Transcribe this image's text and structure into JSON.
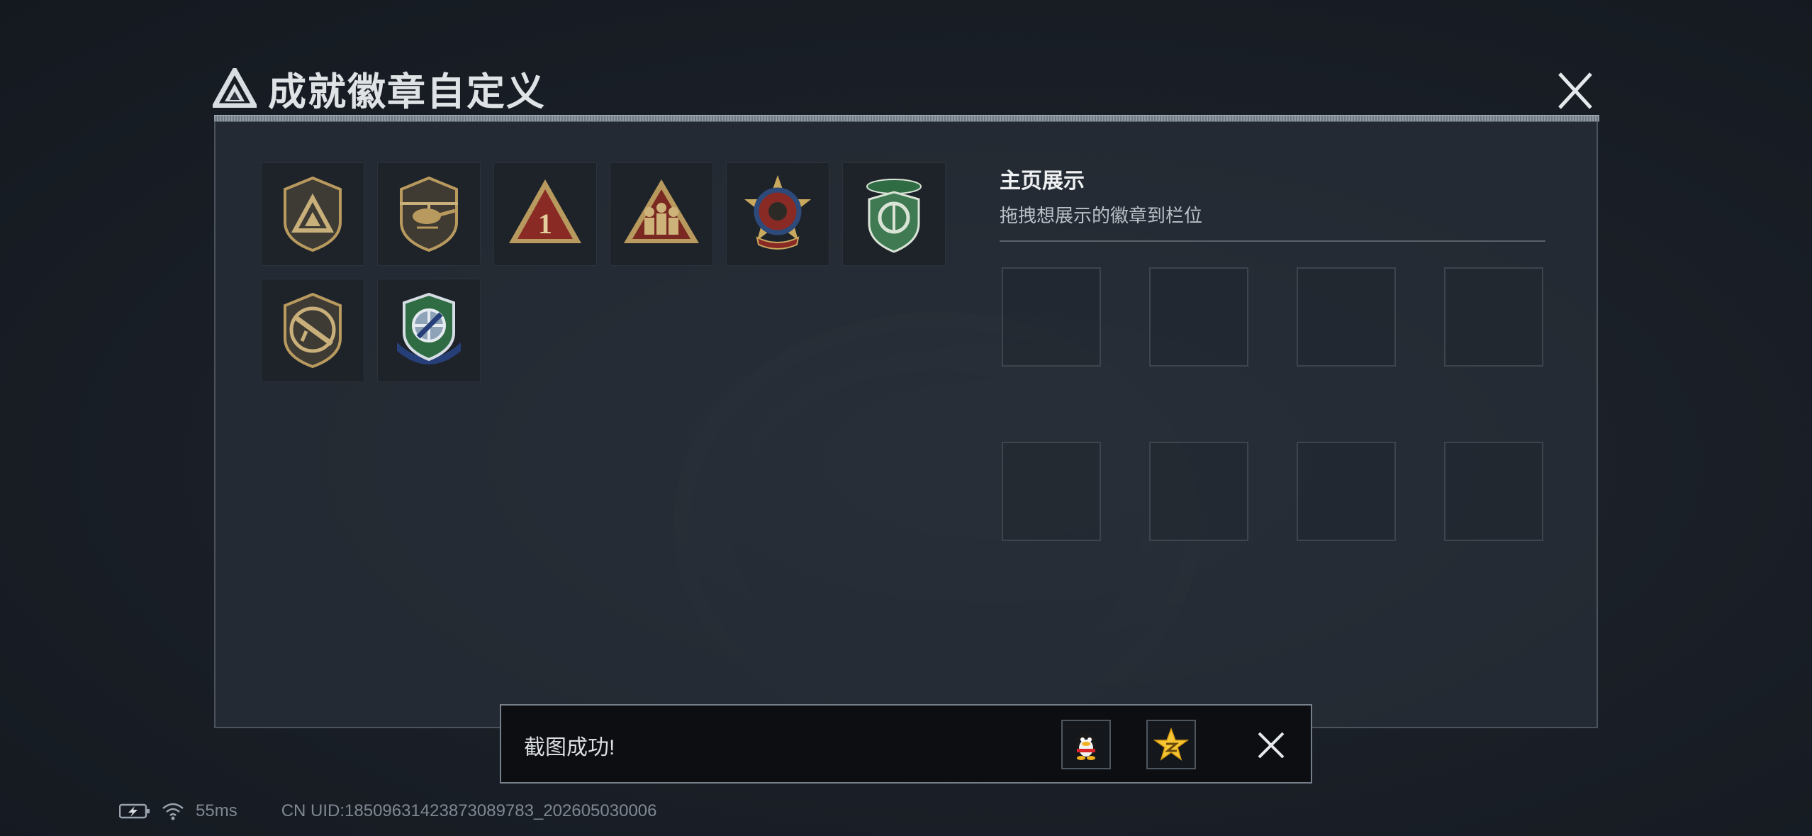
{
  "header": {
    "small_caption": "",
    "title": "成就徽章自定义",
    "close_icon": "close-icon"
  },
  "badges": [
    {
      "name": "triangle-shield-badge",
      "icon": "triangle-shield-icon"
    },
    {
      "name": "helicopter-badge",
      "icon": "helicopter-icon"
    },
    {
      "name": "number-one-triangle-badge",
      "icon": "number-one-icon"
    },
    {
      "name": "squad-triangle-badge",
      "icon": "squad-icon"
    },
    {
      "name": "star-medal-badge",
      "icon": "star-medal-icon"
    },
    {
      "name": "green-shield-badge",
      "icon": "green-shield-icon"
    },
    {
      "name": "rifle-badge",
      "icon": "rifle-icon"
    },
    {
      "name": "crosshair-shield-badge",
      "icon": "crosshair-icon"
    }
  ],
  "showcase": {
    "title": "主页展示",
    "subtitle": "拖拽想展示的徽章到栏位",
    "slot_count": 8
  },
  "toast": {
    "message": "截图成功!",
    "share_buttons": [
      {
        "name": "qq-share-button",
        "icon": "qq-penguin-icon"
      },
      {
        "name": "qzone-share-button",
        "icon": "qzone-star-icon"
      }
    ],
    "close_icon": "close-icon"
  },
  "status_bar": {
    "battery_icon": "battery-charging-icon",
    "wifi_icon": "wifi-icon",
    "ping": "55ms",
    "uid": "CN UID:18509631423873089783_202605030006"
  },
  "colors": {
    "panel_border": "#4a525c",
    "gold": "#b89a5e",
    "green": "#3f7a52",
    "red": "#8a2a25"
  }
}
